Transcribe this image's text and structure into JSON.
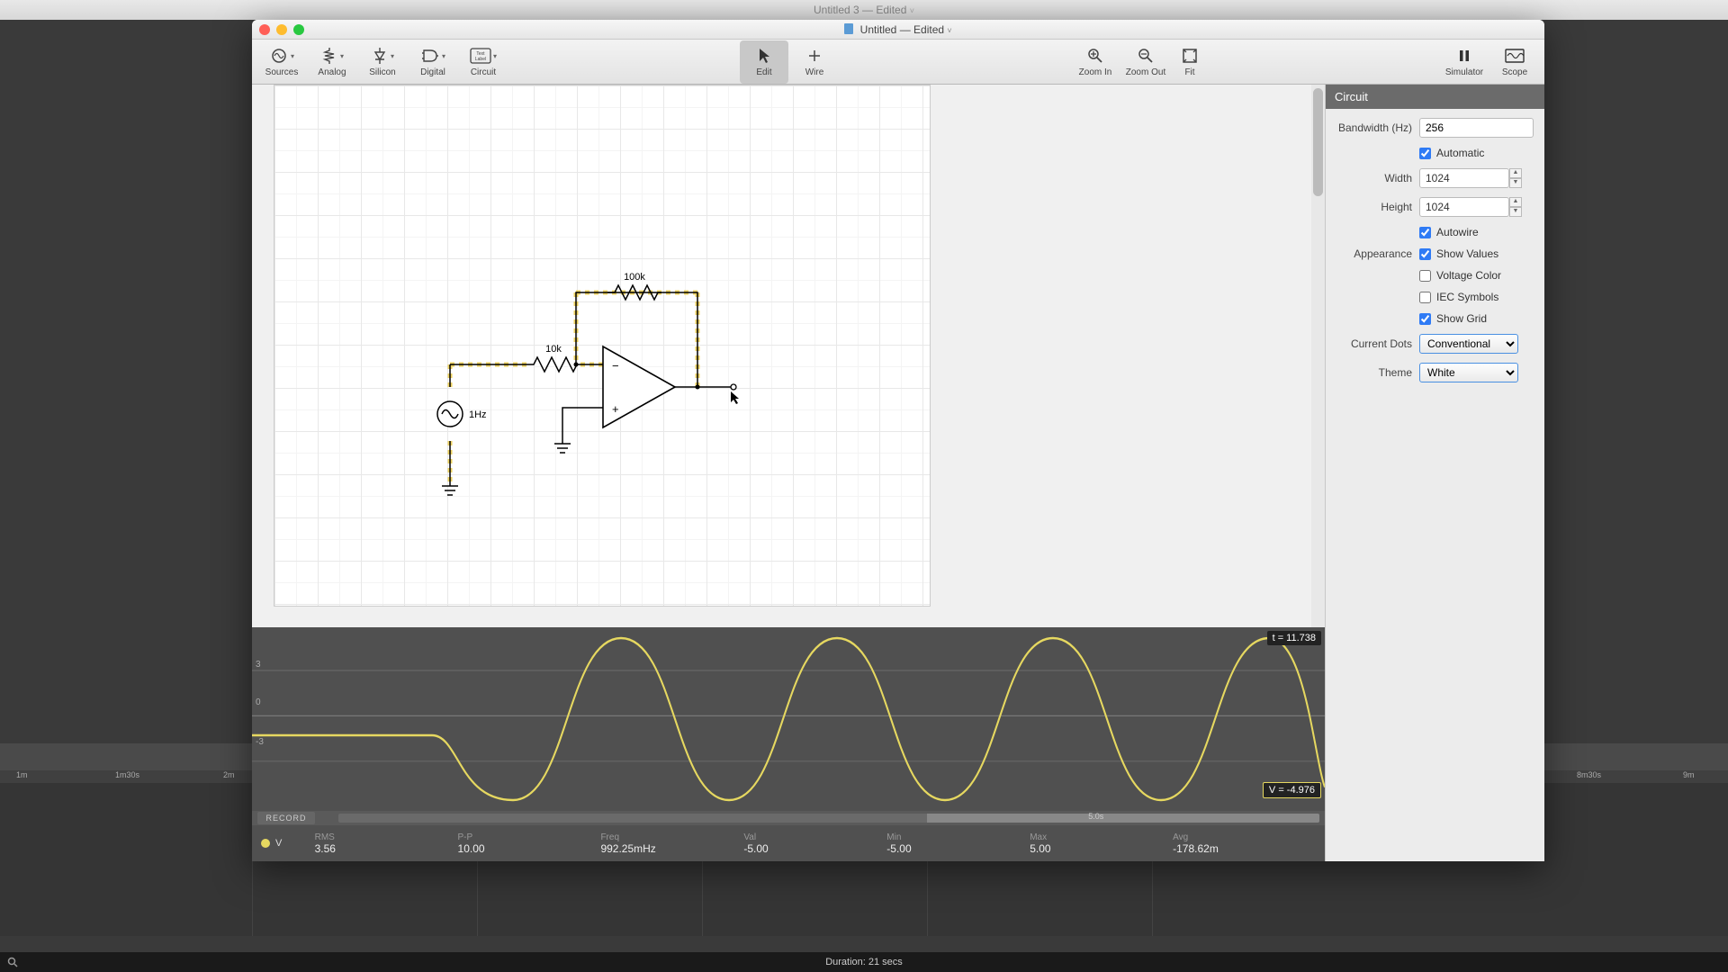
{
  "outer_title": "Untitled 3 — Edited",
  "window_title": "Untitled — Edited",
  "toolbar": {
    "sources": "Sources",
    "analog": "Analog",
    "silicon": "Silicon",
    "digital": "Digital",
    "circuit": "Circuit",
    "edit": "Edit",
    "wire": "Wire",
    "zoom_in": "Zoom In",
    "zoom_out": "Zoom Out",
    "fit": "Fit",
    "simulator": "Simulator",
    "scope": "Scope"
  },
  "inspector": {
    "title": "Circuit",
    "bandwidth_label": "Bandwidth (Hz)",
    "bandwidth_value": "256",
    "automatic_label": "Automatic",
    "automatic_checked": true,
    "width_label": "Width",
    "width_value": "1024",
    "height_label": "Height",
    "height_value": "1024",
    "autowire_label": "Autowire",
    "autowire_checked": true,
    "appearance_label": "Appearance",
    "show_values_label": "Show Values",
    "show_values_checked": true,
    "voltage_color_label": "Voltage Color",
    "voltage_color_checked": false,
    "iec_symbols_label": "IEC Symbols",
    "iec_symbols_checked": false,
    "show_grid_label": "Show Grid",
    "show_grid_checked": true,
    "current_dots_label": "Current Dots",
    "current_dots_value": "Conventional",
    "theme_label": "Theme",
    "theme_value": "White"
  },
  "schematic": {
    "r_feedback": "100k",
    "r_input": "10k",
    "source_freq": "1Hz"
  },
  "scope": {
    "t_label": "t = 11.738",
    "v_label": "V = -4.976",
    "y_ticks": [
      "3",
      "0",
      "-3"
    ],
    "record": "RECORD",
    "scrub_mark": "5.0s",
    "probe_name": "V",
    "stats": {
      "rms_label": "RMS",
      "rms_value": "3.56",
      "pp_label": "P-P",
      "pp_value": "10.00",
      "freq_label": "Freq",
      "freq_value": "992.25mHz",
      "val_label": "Val",
      "val_value": "-5.00",
      "min_label": "Min",
      "min_value": "-5.00",
      "max_label": "Max",
      "max_value": "5.00",
      "avg_label": "Avg",
      "avg_value": "-178.62m"
    }
  },
  "bottom_status": "Duration: 21 secs",
  "timeline_ticks": [
    "1m",
    "1m30s",
    "2m",
    "8m30s",
    "9m"
  ]
}
